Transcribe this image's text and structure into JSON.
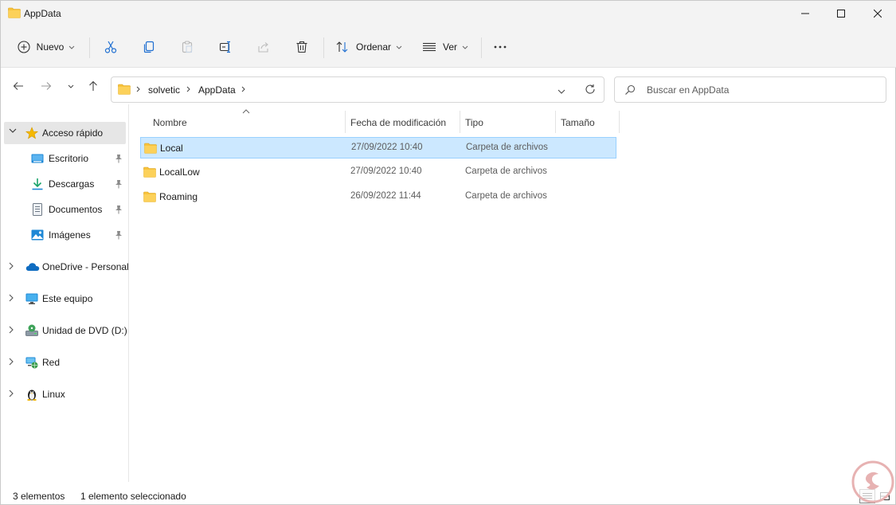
{
  "window": {
    "title": "AppData"
  },
  "toolbar": {
    "new_label": "Nuevo",
    "sort_label": "Ordenar",
    "view_label": "Ver"
  },
  "address": {
    "segments": [
      "solvetic",
      "AppData"
    ]
  },
  "search": {
    "placeholder": "Buscar en AppData"
  },
  "sidebar": {
    "quick_access": "Acceso rápido",
    "items": [
      {
        "label": "Escritorio",
        "icon": "desktop-icon",
        "pinned": true
      },
      {
        "label": "Descargas",
        "icon": "downloads-icon",
        "pinned": true
      },
      {
        "label": "Documentos",
        "icon": "documents-icon",
        "pinned": true
      },
      {
        "label": "Imágenes",
        "icon": "pictures-icon",
        "pinned": true
      }
    ],
    "sections": [
      {
        "label": "OneDrive - Personal",
        "icon": "cloud-icon"
      },
      {
        "label": "Este equipo",
        "icon": "monitor-icon"
      },
      {
        "label": "Unidad de DVD (D:)",
        "icon": "dvd-drive-icon"
      },
      {
        "label": "Red",
        "icon": "network-icon"
      },
      {
        "label": "Linux",
        "icon": "linux-penguin-icon"
      }
    ]
  },
  "columns": {
    "name": "Nombre",
    "modified": "Fecha de modificación",
    "type": "Tipo",
    "size": "Tamaño"
  },
  "files": [
    {
      "name": "Local",
      "modified": "27/09/2022 10:40",
      "type": "Carpeta de archivos",
      "selected": true
    },
    {
      "name": "LocalLow",
      "modified": "27/09/2022 10:40",
      "type": "Carpeta de archivos",
      "selected": false
    },
    {
      "name": "Roaming",
      "modified": "26/09/2022 11:44",
      "type": "Carpeta de archivos",
      "selected": false
    }
  ],
  "status": {
    "count": "3 elementos",
    "selection": "1 elemento seleccionado"
  },
  "colors": {
    "folder": "#f8c33c",
    "selection_bg": "#cce8ff",
    "selection_border": "#99d1ff",
    "accent": "#0067c0"
  }
}
